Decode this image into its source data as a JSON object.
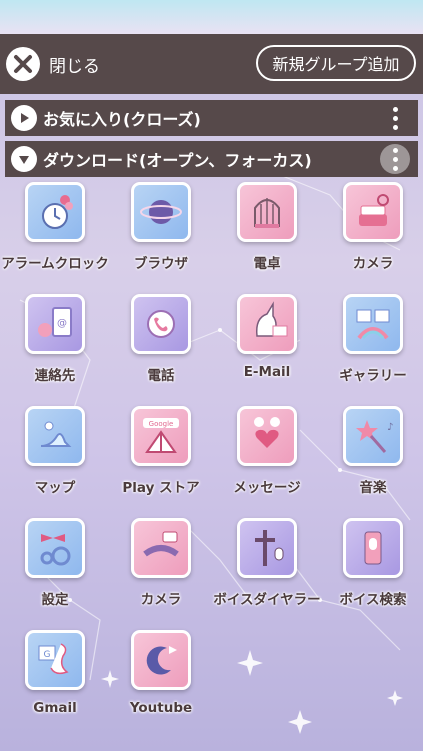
{
  "header": {
    "close_label": "閉じる",
    "new_group_label": "新規グループ追加"
  },
  "folders": [
    {
      "title": "お気に入り(クローズ)"
    },
    {
      "title": "ダウンロード(オープン、フォーカス)"
    }
  ],
  "apps": [
    {
      "label": "アラームクロック",
      "icon": "alarm-clock-icon",
      "color": "blue"
    },
    {
      "label": "ブラウザ",
      "icon": "planet-icon",
      "color": "blue"
    },
    {
      "label": "電卓",
      "icon": "birdcage-icon",
      "color": "pink"
    },
    {
      "label": "カメラ",
      "icon": "camera-cake-icon",
      "color": "pink"
    },
    {
      "label": "連絡先",
      "icon": "contacts-icon",
      "color": "lav"
    },
    {
      "label": "電話",
      "icon": "phone-icon",
      "color": "lav"
    },
    {
      "label": "E-Mail",
      "icon": "unicorn-mail-icon",
      "color": "pink"
    },
    {
      "label": "ギャラリー",
      "icon": "gallery-rainbow-icon",
      "color": "blue"
    },
    {
      "label": "マップ",
      "icon": "glass-slipper-icon",
      "color": "blue"
    },
    {
      "label": "Play ストア",
      "icon": "google-play-tent-icon",
      "color": "pink"
    },
    {
      "label": "メッセージ",
      "icon": "winged-heart-icon",
      "color": "pink"
    },
    {
      "label": "音楽",
      "icon": "star-wand-icon",
      "color": "blue"
    },
    {
      "label": "設定",
      "icon": "bow-gears-icon",
      "color": "blue"
    },
    {
      "label": "カメラ",
      "icon": "video-camera-candy-icon",
      "color": "pink"
    },
    {
      "label": "ボイスダイヤラー",
      "icon": "cross-mic-icon",
      "color": "lav"
    },
    {
      "label": "ボイス検索",
      "icon": "mic-phone-icon",
      "color": "lav"
    },
    {
      "label": "Gmail",
      "icon": "swan-mail-icon",
      "color": "blue"
    },
    {
      "label": "Youtube",
      "icon": "moon-play-icon",
      "color": "pink"
    }
  ]
}
